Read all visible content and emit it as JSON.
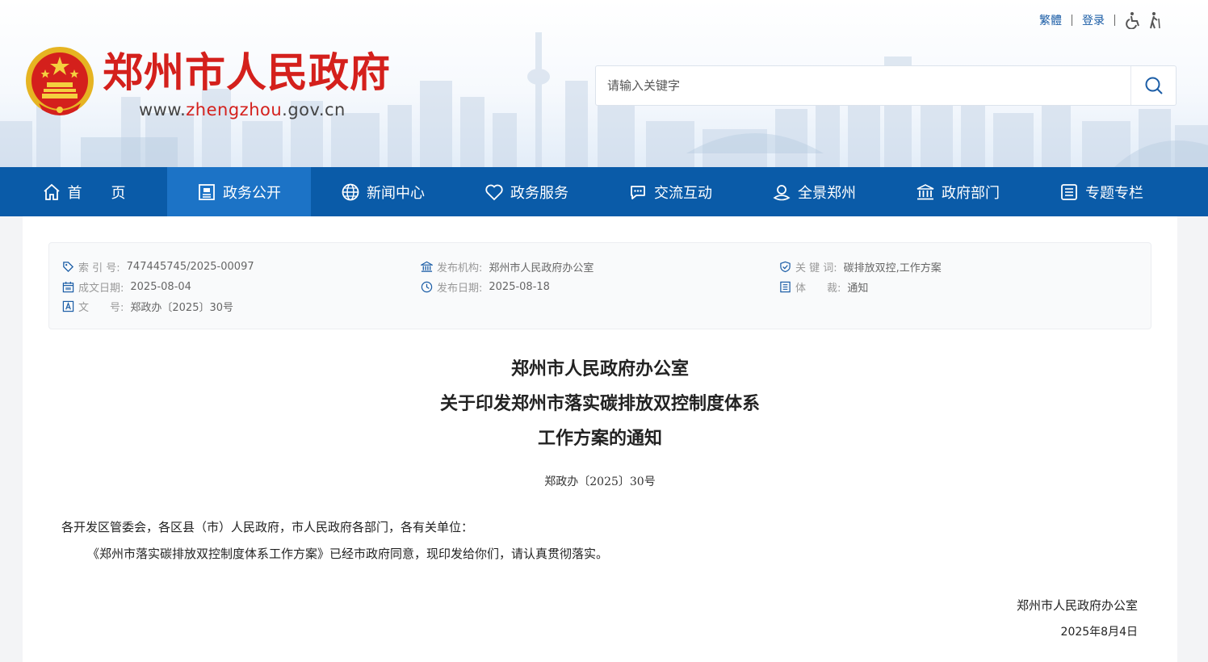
{
  "header": {
    "site_name": "郑州市人民政府",
    "site_url_prefix": "www.",
    "site_url_highlight": "zhengzhou",
    "site_url_suffix": ".gov.cn",
    "toplinks": {
      "traditional": "繁體",
      "login": "登录"
    },
    "search": {
      "placeholder": "请输入关键字"
    }
  },
  "nav": {
    "items": [
      {
        "label": "首　　页",
        "icon": "home-icon"
      },
      {
        "label": "政务公开",
        "icon": "document-icon"
      },
      {
        "label": "新闻中心",
        "icon": "globe-icon"
      },
      {
        "label": "政务服务",
        "icon": "heart-icon"
      },
      {
        "label": "交流互动",
        "icon": "chat-icon"
      },
      {
        "label": "全景郑州",
        "icon": "panorama-icon"
      },
      {
        "label": "政府部门",
        "icon": "building-icon"
      },
      {
        "label": "专题专栏",
        "icon": "list-icon"
      }
    ],
    "active_index": 1
  },
  "meta": {
    "index_no": {
      "label": "索 引 号:",
      "value": "747445745/2025-00097"
    },
    "publisher": {
      "label": "发布机构:",
      "value": "郑州市人民政府办公室"
    },
    "keywords": {
      "label": "关 键 词:",
      "value": "碳排放双控,工作方案"
    },
    "created_date": {
      "label": "成文日期:",
      "value": "2025-08-04"
    },
    "published_date": {
      "label": "发布日期:",
      "value": "2025-08-18"
    },
    "genre": {
      "label": "体　　裁:",
      "value": "通知"
    },
    "doc_no": {
      "label": "文　　号:",
      "value": "郑政办〔2025〕30号"
    }
  },
  "document": {
    "title_line1": "郑州市人民政府办公室",
    "title_line2": "关于印发郑州市落实碳排放双控制度体系",
    "title_line3": "工作方案的通知",
    "doc_number": "郑政办〔2025〕30号",
    "salutation": "各开发区管委会，各区县（市）人民政府，市人民政府各部门，各有关单位：",
    "body": "《郑州市落实碳排放双控制度体系工作方案》已经市政府同意，现印发给你们，请认真贯彻落实。",
    "sign_org": "郑州市人民政府办公室",
    "sign_date": "2025年8月4日"
  },
  "colors": {
    "brand_red": "#d4201c",
    "nav_blue": "#0a5ba8",
    "nav_active": "#1c73c6",
    "link_blue": "#1b5da6"
  }
}
